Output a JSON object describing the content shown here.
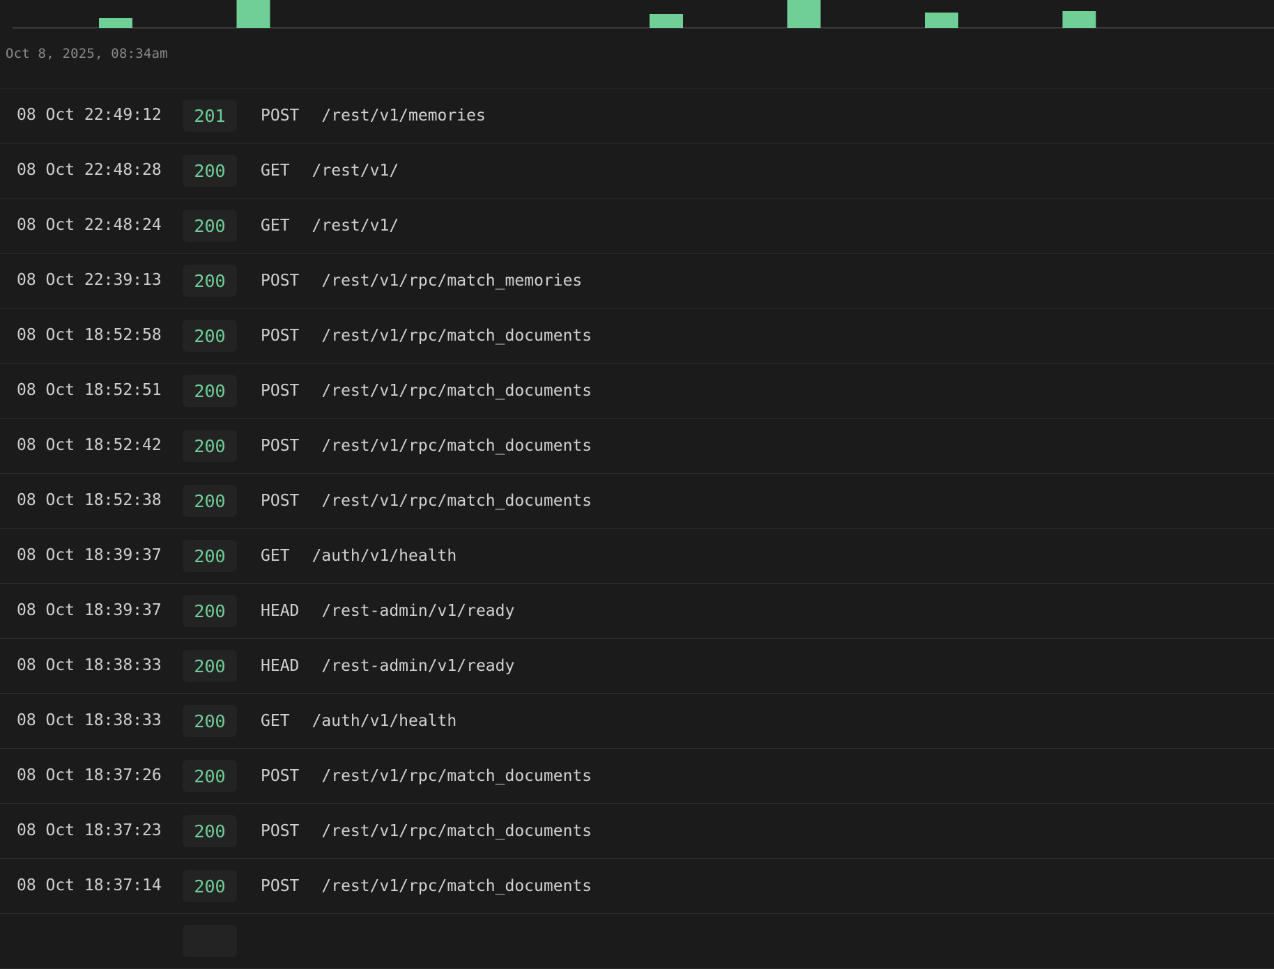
{
  "chart": {
    "caption": "Oct 8, 2025, 08:34am",
    "bar_color": "#6fcf97",
    "bars": [
      {
        "slot": 0,
        "value": 0.35
      },
      {
        "slot": 1,
        "value": 1.0
      },
      {
        "slot": 4,
        "value": 0.5
      },
      {
        "slot": 5,
        "value": 1.0
      },
      {
        "slot": 6,
        "value": 0.55
      },
      {
        "slot": 7,
        "value": 0.6
      }
    ]
  },
  "colors": {
    "status_ok": "#6fcf97",
    "background": "#1b1b1b",
    "divider": "#2b2b2b"
  },
  "logs": [
    {
      "timestamp": "08 Oct 22:49:12",
      "status": "201",
      "method": "POST",
      "path": "/rest/v1/memories"
    },
    {
      "timestamp": "08 Oct 22:48:28",
      "status": "200",
      "method": "GET",
      "path": "/rest/v1/"
    },
    {
      "timestamp": "08 Oct 22:48:24",
      "status": "200",
      "method": "GET",
      "path": "/rest/v1/"
    },
    {
      "timestamp": "08 Oct 22:39:13",
      "status": "200",
      "method": "POST",
      "path": "/rest/v1/rpc/match_memories"
    },
    {
      "timestamp": "08 Oct 18:52:58",
      "status": "200",
      "method": "POST",
      "path": "/rest/v1/rpc/match_documents"
    },
    {
      "timestamp": "08 Oct 18:52:51",
      "status": "200",
      "method": "POST",
      "path": "/rest/v1/rpc/match_documents"
    },
    {
      "timestamp": "08 Oct 18:52:42",
      "status": "200",
      "method": "POST",
      "path": "/rest/v1/rpc/match_documents"
    },
    {
      "timestamp": "08 Oct 18:52:38",
      "status": "200",
      "method": "POST",
      "path": "/rest/v1/rpc/match_documents"
    },
    {
      "timestamp": "08 Oct 18:39:37",
      "status": "200",
      "method": "GET",
      "path": "/auth/v1/health"
    },
    {
      "timestamp": "08 Oct 18:39:37",
      "status": "200",
      "method": "HEAD",
      "path": "/rest-admin/v1/ready"
    },
    {
      "timestamp": "08 Oct 18:38:33",
      "status": "200",
      "method": "HEAD",
      "path": "/rest-admin/v1/ready"
    },
    {
      "timestamp": "08 Oct 18:38:33",
      "status": "200",
      "method": "GET",
      "path": "/auth/v1/health"
    },
    {
      "timestamp": "08 Oct 18:37:26",
      "status": "200",
      "method": "POST",
      "path": "/rest/v1/rpc/match_documents"
    },
    {
      "timestamp": "08 Oct 18:37:23",
      "status": "200",
      "method": "POST",
      "path": "/rest/v1/rpc/match_documents"
    },
    {
      "timestamp": "08 Oct 18:37:14",
      "status": "200",
      "method": "POST",
      "path": "/rest/v1/rpc/match_documents"
    },
    {
      "timestamp": "",
      "status": "",
      "method": "",
      "path": ""
    }
  ]
}
